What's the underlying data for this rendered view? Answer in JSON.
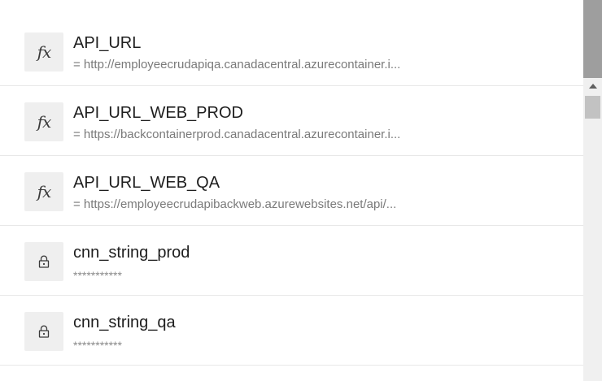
{
  "variables": [
    {
      "icon": "function-icon",
      "name": "API_URL",
      "value": "= http://employeecrudapiqa.canadacentral.azurecontainer.i..."
    },
    {
      "icon": "function-icon",
      "name": "API_URL_WEB_PROD",
      "value": "= https://backcontainerprod.canadacentral.azurecontainer.i..."
    },
    {
      "icon": "function-icon",
      "name": "API_URL_WEB_QA",
      "value": "= https://employeecrudapibackweb.azurewebsites.net/api/..."
    },
    {
      "icon": "lock-icon",
      "name": "cnn_string_prod",
      "value": "***********"
    },
    {
      "icon": "lock-icon",
      "name": "cnn_string_qa",
      "value": "***********"
    }
  ],
  "icons": {
    "function_glyph": "fx"
  },
  "colors": {
    "icon_background": "#efefef",
    "divider": "#e8e8e8",
    "overlay": "#9e9e9e"
  }
}
